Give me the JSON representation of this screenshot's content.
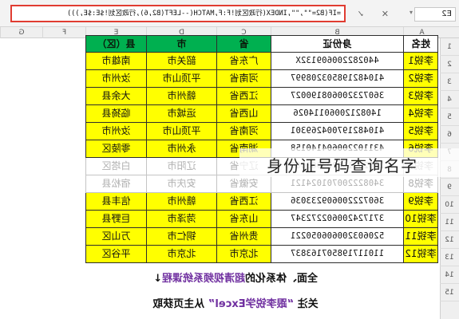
{
  "formula_bar": {
    "name_box": "E2",
    "name_arrow": "▾",
    "fx_icons": "✕ ✓ fx",
    "formula": "=IF(B2=\"\",\"\",INDEX(行政区划!F:F,MATCH(--LEFT(B2,6),行政区划!$E:$E,)))"
  },
  "columns": [
    "A",
    "B",
    "C",
    "D",
    "E",
    "F",
    "G"
  ],
  "rows": [
    "1",
    "2",
    "3",
    "4",
    "5",
    "6",
    "7",
    "8",
    "9",
    "10",
    "11",
    "12",
    "13",
    "14",
    "15"
  ],
  "table": {
    "headers": {
      "name": "姓名",
      "id": "身份证",
      "province": "省",
      "city": "市",
      "county": "县（区）"
    },
    "records": [
      {
        "name": "李锐1",
        "id": "440282200609132X",
        "province": "广东省",
        "city": "韶关市",
        "county": "南雄市"
      },
      {
        "name": "李锐2",
        "id": "410482198503208997",
        "province": "河南省",
        "city": "平顶山市",
        "county": "汝州市"
      },
      {
        "name": "李锐3",
        "id": "360723200608190027",
        "province": "江西省",
        "city": "赣州市",
        "county": "大余县"
      },
      {
        "name": "李锐4",
        "id": "14082120060114026",
        "province": "山西省",
        "city": "运城市",
        "county": "临猗县"
      },
      {
        "name": "李锐5",
        "id": "410482197004269301",
        "province": "河南省",
        "city": "平顶山市",
        "county": "汝州市"
      },
      {
        "name": "李锐6",
        "id": "431102200604140158",
        "province": "湖南省",
        "city": "永州市",
        "county": "零陵区"
      },
      {
        "name": "李锐7",
        "id": "210202198203060000",
        "province": "辽宁省",
        "city": "辽阳市",
        "county": "白塔区"
      },
      {
        "name": "李锐8",
        "id": "340822200701024121",
        "province": "安徽省",
        "city": "安庆市",
        "county": "宿松县"
      },
      {
        "name": "李锐9",
        "id": "360722200609233036",
        "province": "江西省",
        "city": "赣州市",
        "county": "信丰县"
      },
      {
        "name": "李锐10",
        "id": "371724200602272347",
        "province": "山东省",
        "city": "菏泽市",
        "county": "巨野县"
      },
      {
        "name": "李锐11",
        "id": "520603200606050221",
        "province": "贵州省",
        "city": "铜仁市",
        "county": "万山区"
      },
      {
        "name": "李锐12",
        "id": "110117198507163837",
        "province": "北京市",
        "city": "北京市",
        "county": "平谷区"
      }
    ]
  },
  "overlay_caption": "身份证号码查询名字",
  "promo": {
    "line1_pre": "全面、体系化的",
    "line1_hl": "超清视频系统课程",
    "line1_post": "↓",
    "line2_pre": "关注 ",
    "line2_hl": "“跟李锐学Excel”",
    "line2_post": " 从主页获取"
  },
  "colors": {
    "header_green": "#00b050",
    "highlight_yellow": "#ffff00",
    "formula_border": "#e03c31",
    "promo_purple": "#7030a0"
  }
}
